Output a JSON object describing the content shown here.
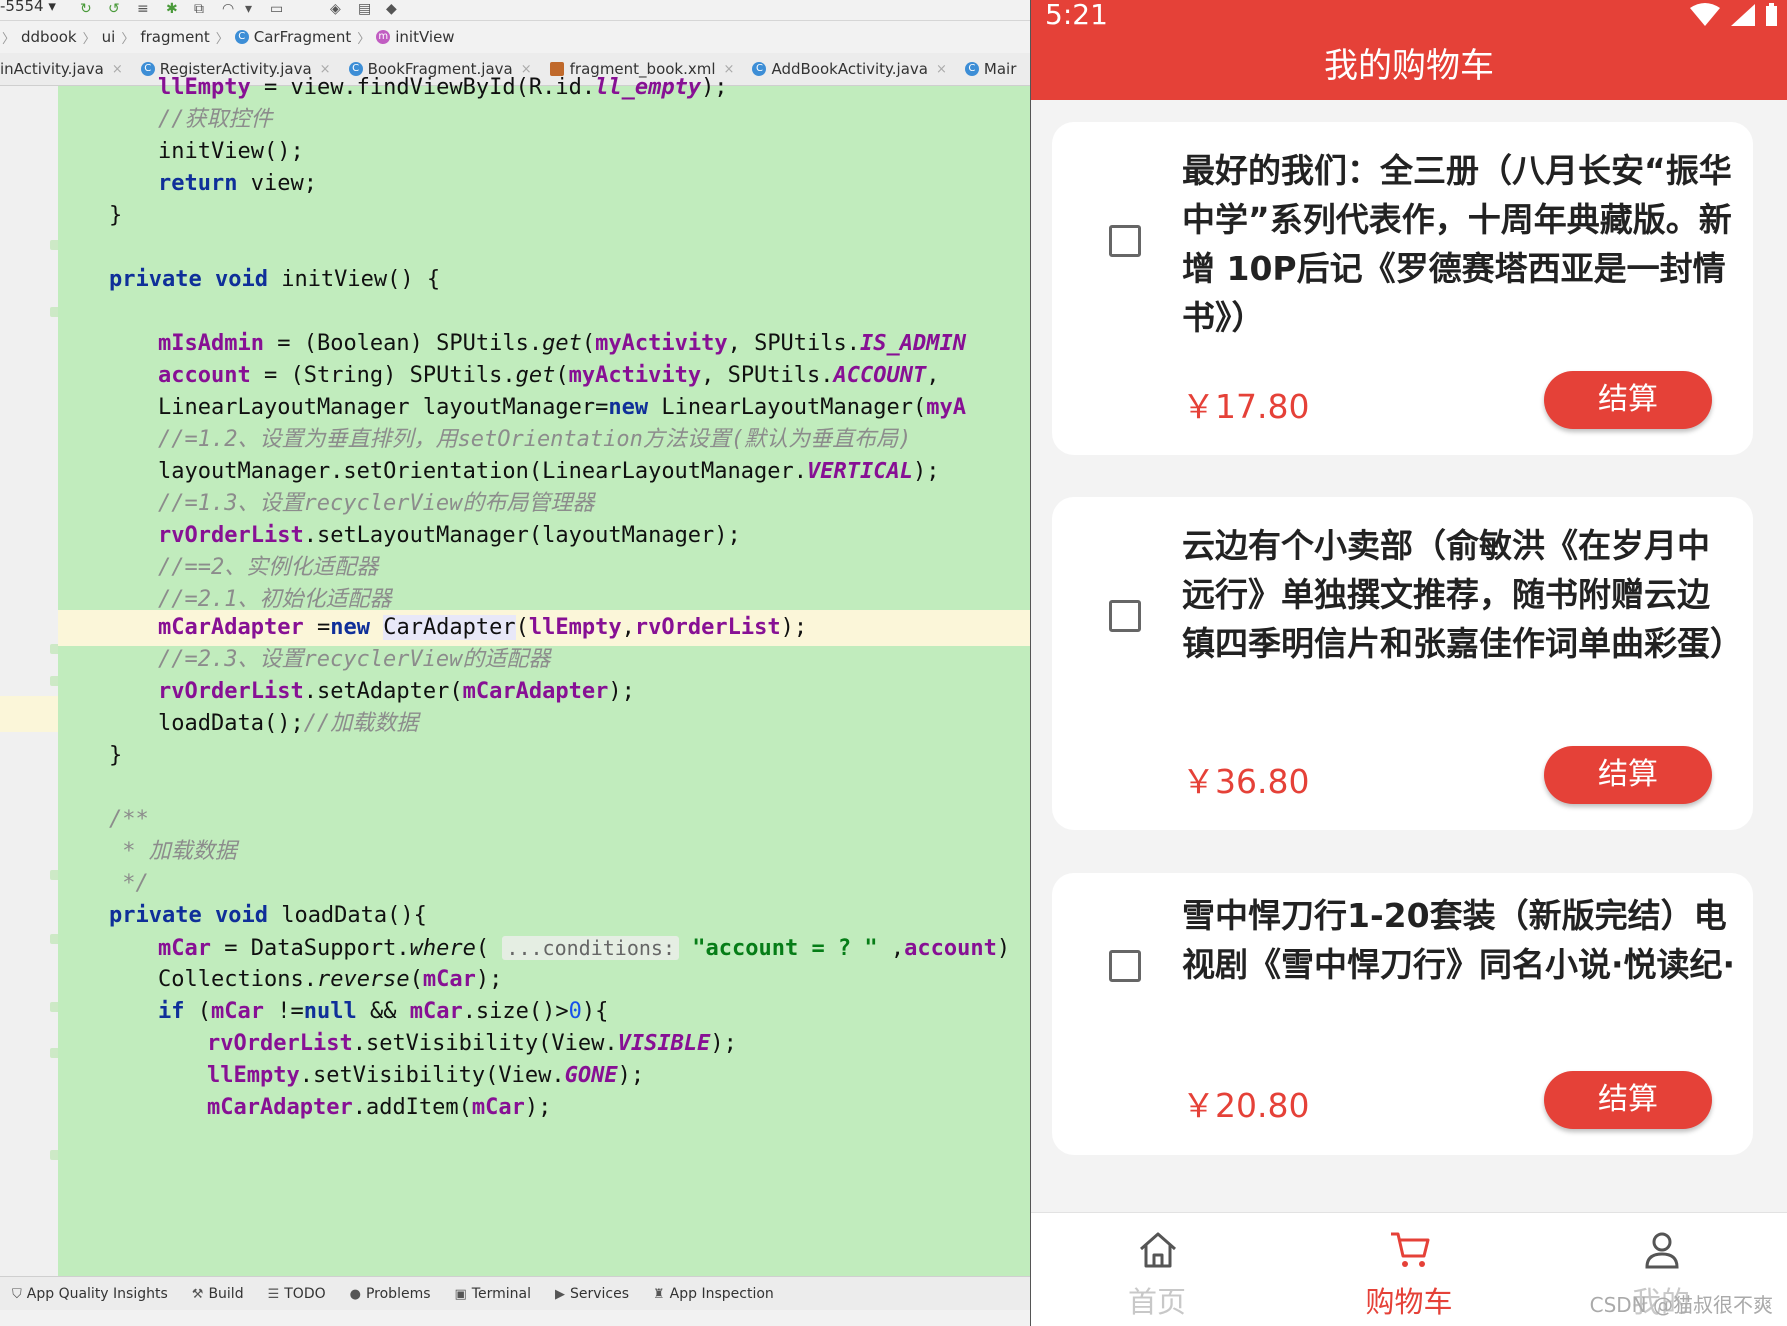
{
  "ide": {
    "toolbar_text": "-5554 ▾",
    "breadcrumb": [
      "ddbook",
      "ui",
      "fragment",
      "CarFragment",
      "initView"
    ],
    "tabs": [
      "inActivity.java",
      "RegisterActivity.java",
      "BookFragment.java",
      "fragment_book.xml",
      "AddBookActivity.java",
      "Mair"
    ],
    "code": {
      "l1": [
        "llEmpty",
        " = view.findViewById(R.id.",
        "ll_empty",
        ");"
      ],
      "l2": "//获取控件",
      "l3": "initView();",
      "l4": [
        "return",
        " view;"
      ],
      "l5": "}",
      "l7": [
        "private",
        " ",
        "void",
        " initView() {"
      ],
      "l9": [
        "mIsAdmin",
        " = (Boolean) SPUtils.",
        "get",
        "(",
        "myActivity",
        ", SPUtils.",
        "IS_ADMIN"
      ],
      "l10": [
        "account",
        " = (String) SPUtils.",
        "get",
        "(",
        "myActivity",
        ", SPUtils.",
        "ACCOUNT",
        ","
      ],
      "l11": [
        "LinearLayoutManager layoutManager=",
        "new",
        " LinearLayoutManager(",
        "myA"
      ],
      "l12": "//=1.2、设置为垂直排列，用setOrientation方法设置(默认为垂直布局)",
      "l13": [
        "layoutManager.setOrientation(LinearLayoutManager.",
        "VERTICAL",
        ");"
      ],
      "l14": "//=1.3、设置recyclerView的布局管理器",
      "l15": [
        "rvOrderList",
        ".setLayoutManager(layoutManager);"
      ],
      "l16": "//==2、实例化适配器",
      "l17": "//=2.1、初始化适配器",
      "l18": [
        "mCarAdapter",
        " =",
        "new",
        " ",
        "CarAdapter",
        "(",
        "llEmpty",
        ",",
        "rvOrderList",
        ");"
      ],
      "l19": "//=2.3、设置recyclerView的适配器",
      "l20": [
        "rvOrderList",
        ".setAdapter(",
        "mCarAdapter",
        ");"
      ],
      "l21": [
        "loadData();",
        "//加载数据"
      ],
      "l22": "}",
      "l24": "/**",
      "l25": " * 加载数据",
      "l26": " */",
      "l27": [
        "private",
        " ",
        "void",
        " loadData(){"
      ],
      "l28": [
        "mCar",
        " = DataSupport.",
        "where",
        "( ",
        "...conditions:",
        " ",
        "\"account = ? \"",
        " ,",
        "account",
        ")"
      ],
      "l29": [
        "Collections.",
        "reverse",
        "(",
        "mCar",
        ");"
      ],
      "l30": [
        "if",
        " (",
        "mCar",
        " !=",
        "null",
        " && ",
        "mCar",
        ".size()>",
        "0",
        "){"
      ],
      "l31": [
        "rvOrderList",
        ".setVisibility(View.",
        "VISIBLE",
        ");"
      ],
      "l32": [
        "llEmpty",
        ".setVisibility(View.",
        "GONE",
        ");"
      ],
      "l33": [
        "mCarAdapter",
        ".addItem(",
        "mCar",
        ");"
      ]
    },
    "statusbar": [
      "App Quality Insights",
      "Build",
      "TODO",
      "Problems",
      "Terminal",
      "Services",
      "App Inspection"
    ]
  },
  "phone": {
    "time": "5:21",
    "title": "我的购物车",
    "items": [
      {
        "title": "最好的我们：全三册（八月长安“振华中学”系列代表作，十周年典藏版。新增 10P后记《罗德赛塔西亚是一封情书》）",
        "price": "￥17.80",
        "pay": "结算"
      },
      {
        "title": "云边有个小卖部（俞敏洪《在岁月中远行》单独撰文推荐，随书附赠云边镇四季明信片和张嘉佳作词单曲彩蛋）",
        "price": "￥36.80",
        "pay": "结算"
      },
      {
        "title": " 雪中悍刀行1-20套装（新版完结）电视剧《雪中悍刀行》同名小说·悦读纪·",
        "price": "￥20.80",
        "pay": "结算"
      }
    ],
    "nav": [
      "首页",
      "购物车",
      "我的"
    ],
    "watermark": "CSDN @猫叔很不爽",
    "colors": {
      "accent": "#e54138",
      "nav_inactive": "#c8c8c8"
    }
  }
}
